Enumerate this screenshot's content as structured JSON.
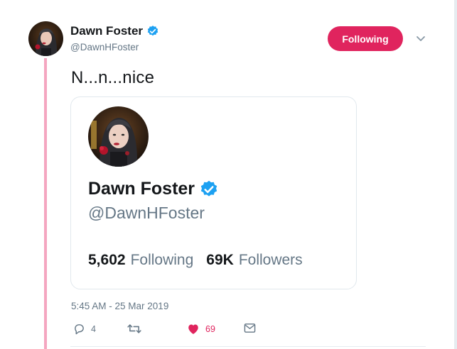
{
  "tweet": {
    "author": {
      "display_name": "Dawn Foster",
      "handle": "@DawnHFoster",
      "verified": true
    },
    "follow_button_label": "Following",
    "text": "N...n...nice",
    "card": {
      "display_name": "Dawn Foster",
      "handle": "@DawnHFoster",
      "following_count": "5,602",
      "following_label": "Following",
      "followers_count": "69K",
      "followers_label": "Followers"
    },
    "timestamp": "5:45 AM - 25 Mar 2019",
    "actions": {
      "reply_count": "4",
      "retweet_count": "",
      "like_count": "69"
    }
  },
  "colors": {
    "accent_pink": "#e0245e",
    "thread_line": "#f4a6c0",
    "verified_blue": "#1da1f2",
    "secondary_text": "#657786",
    "primary_text": "#14171a"
  },
  "icons": {
    "verified": "verified-badge-icon",
    "caret": "chevron-down-icon",
    "reply": "reply-icon",
    "retweet": "retweet-icon",
    "like": "heart-icon",
    "dm": "envelope-icon"
  }
}
